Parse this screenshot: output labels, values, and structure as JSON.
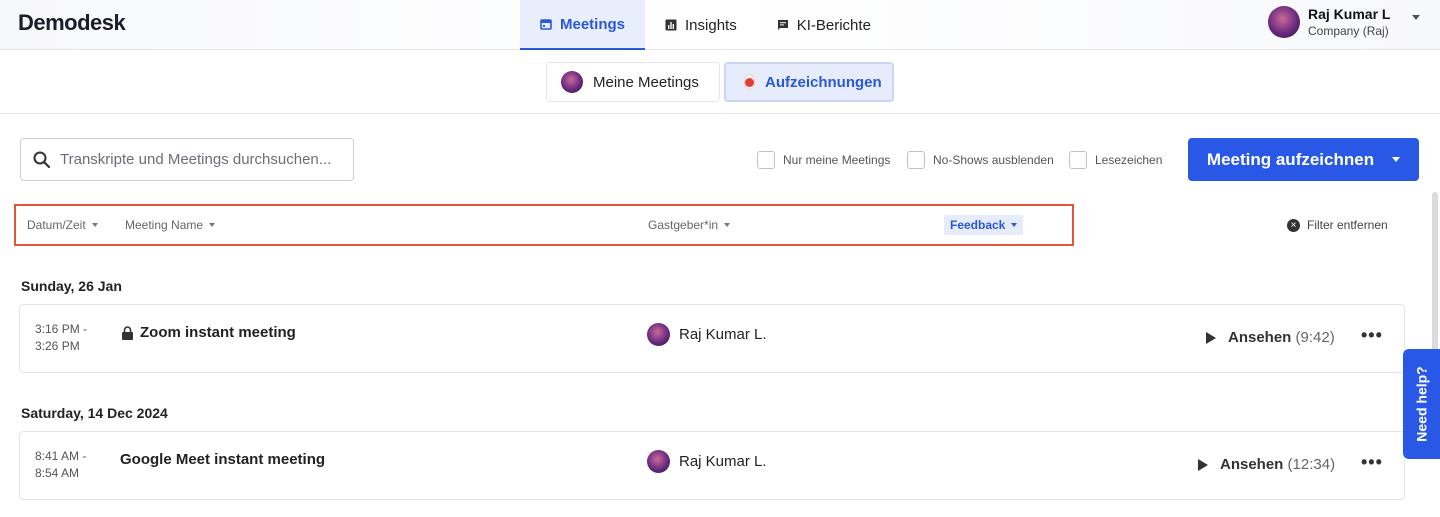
{
  "app": {
    "logo": "Demodesk"
  },
  "nav": [
    {
      "label": "Meetings",
      "icon": "calendar-icon",
      "active": true
    },
    {
      "label": "Insights",
      "icon": "bar-chart-icon",
      "active": false
    },
    {
      "label": "KI-Berichte",
      "icon": "chat-report-icon",
      "active": false
    }
  ],
  "user": {
    "name": "Raj Kumar L",
    "company": "Company (Raj)"
  },
  "subtabs": {
    "mine": "Meine Meetings",
    "recordings": "Aufzeichnungen"
  },
  "search": {
    "placeholder": "Transkripte und Meetings durchsuchen..."
  },
  "filters": {
    "only_mine": "Nur meine Meetings",
    "hide_noshows": "No-Shows ausblenden",
    "bookmarks": "Lesezeichen",
    "clear": "Filter entfernen"
  },
  "record_button": "Meeting aufzeichnen",
  "columns": {
    "datetime": "Datum/Zeit",
    "name": "Meeting Name",
    "host": "Gastgeber*in",
    "feedback": "Feedback"
  },
  "groups": [
    {
      "date": "Sunday, 26 Jan",
      "meetings": [
        {
          "start": "3:16 PM -",
          "end": "3:26 PM",
          "title": "Zoom instant meeting",
          "locked": true,
          "host": "Raj Kumar L.",
          "watch": "Ansehen",
          "duration": "(9:42)"
        }
      ]
    },
    {
      "date": "Saturday, 14 Dec 2024",
      "meetings": [
        {
          "start": "8:41 AM -",
          "end": "8:54 AM",
          "title": "Google Meet instant meeting",
          "locked": false,
          "host": "Raj Kumar L.",
          "watch": "Ansehen",
          "duration": "(12:34)"
        }
      ]
    }
  ],
  "help": "Need help?"
}
